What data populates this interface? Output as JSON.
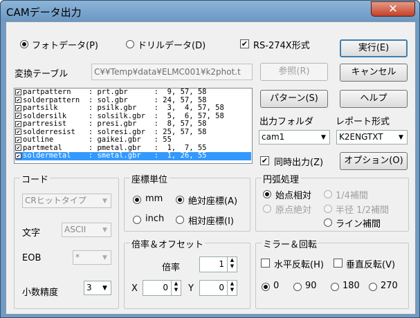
{
  "window": {
    "title": "CAMデータ出力",
    "close_label": "✕"
  },
  "mode": {
    "photo_label": "フォトデータ(P)",
    "drill_label": "ドリルデータ(D)",
    "rs274x_label": "RS-274X形式"
  },
  "conversion": {
    "label": "変換テーブル",
    "path": "C¥¥Temp¥data¥ELMC001¥k2phot.t",
    "browse_label": "参照(R)"
  },
  "layers": [
    {
      "text": "partpattern    : prt.gbr      :  9, 57, 58"
    },
    {
      "text": "solderpattern  : sol.gbr      : 24, 57, 58"
    },
    {
      "text": "partsilk       : psilk.gbr    :  3,  4, 57, 58"
    },
    {
      "text": "soldersilk     : solsilk.gbr  :  5,  6, 57, 58"
    },
    {
      "text": "partresist     : presi.gbr    :  8, 57, 58"
    },
    {
      "text": "solderresist   : solresi.gbr  : 25, 57, 58"
    },
    {
      "text": "outline        : gaikei.gbr   : 55"
    },
    {
      "text": "partmetal      : pmetal.gbr   :  1,  7, 55"
    },
    {
      "text": "soldermetal    : smetal.gbr   :  1, 26, 55"
    }
  ],
  "buttons": {
    "execute": "実行(E)",
    "cancel": "キャンセル",
    "pattern": "パターン(S)",
    "help": "ヘルプ",
    "option": "オプション(O)"
  },
  "output": {
    "folder_label": "出力フォルダ",
    "folder_value": "cam1",
    "report_label": "レポート形式",
    "report_value": "K2ENGTXT",
    "simultaneous_label": "同時出力(Z)"
  },
  "code": {
    "group": "コード",
    "type_value": "CRヒットタイプ",
    "charset_label": "文字",
    "charset_value": "ASCII",
    "eob_label": "EOB",
    "eob_value": "*",
    "decimal_label": "小数精度",
    "decimal_value": "3"
  },
  "coord": {
    "group": "座標単位",
    "mm": "mm",
    "absolute": "絶対座標(A)",
    "inch": "inch",
    "relative": "相対座標(I)"
  },
  "arc": {
    "group": "円弧処理",
    "start_relative": "始点相対",
    "quarter": "1/4補間",
    "origin_absolute": "原点絶対",
    "half_radius": "半径 1/2補間",
    "line": "ライン補間"
  },
  "scale": {
    "group": "倍率＆オフセット",
    "scale_label": "倍率",
    "scale_value": "1",
    "x_label": "X",
    "x_value": "0",
    "y_label": "Y",
    "y_value": "0"
  },
  "mirror": {
    "group": "ミラー＆回転",
    "horizontal": "水平反転(H)",
    "vertical": "垂直反転(V)",
    "rot0": "0",
    "rot90": "90",
    "rot180": "180",
    "rot270": "270"
  }
}
